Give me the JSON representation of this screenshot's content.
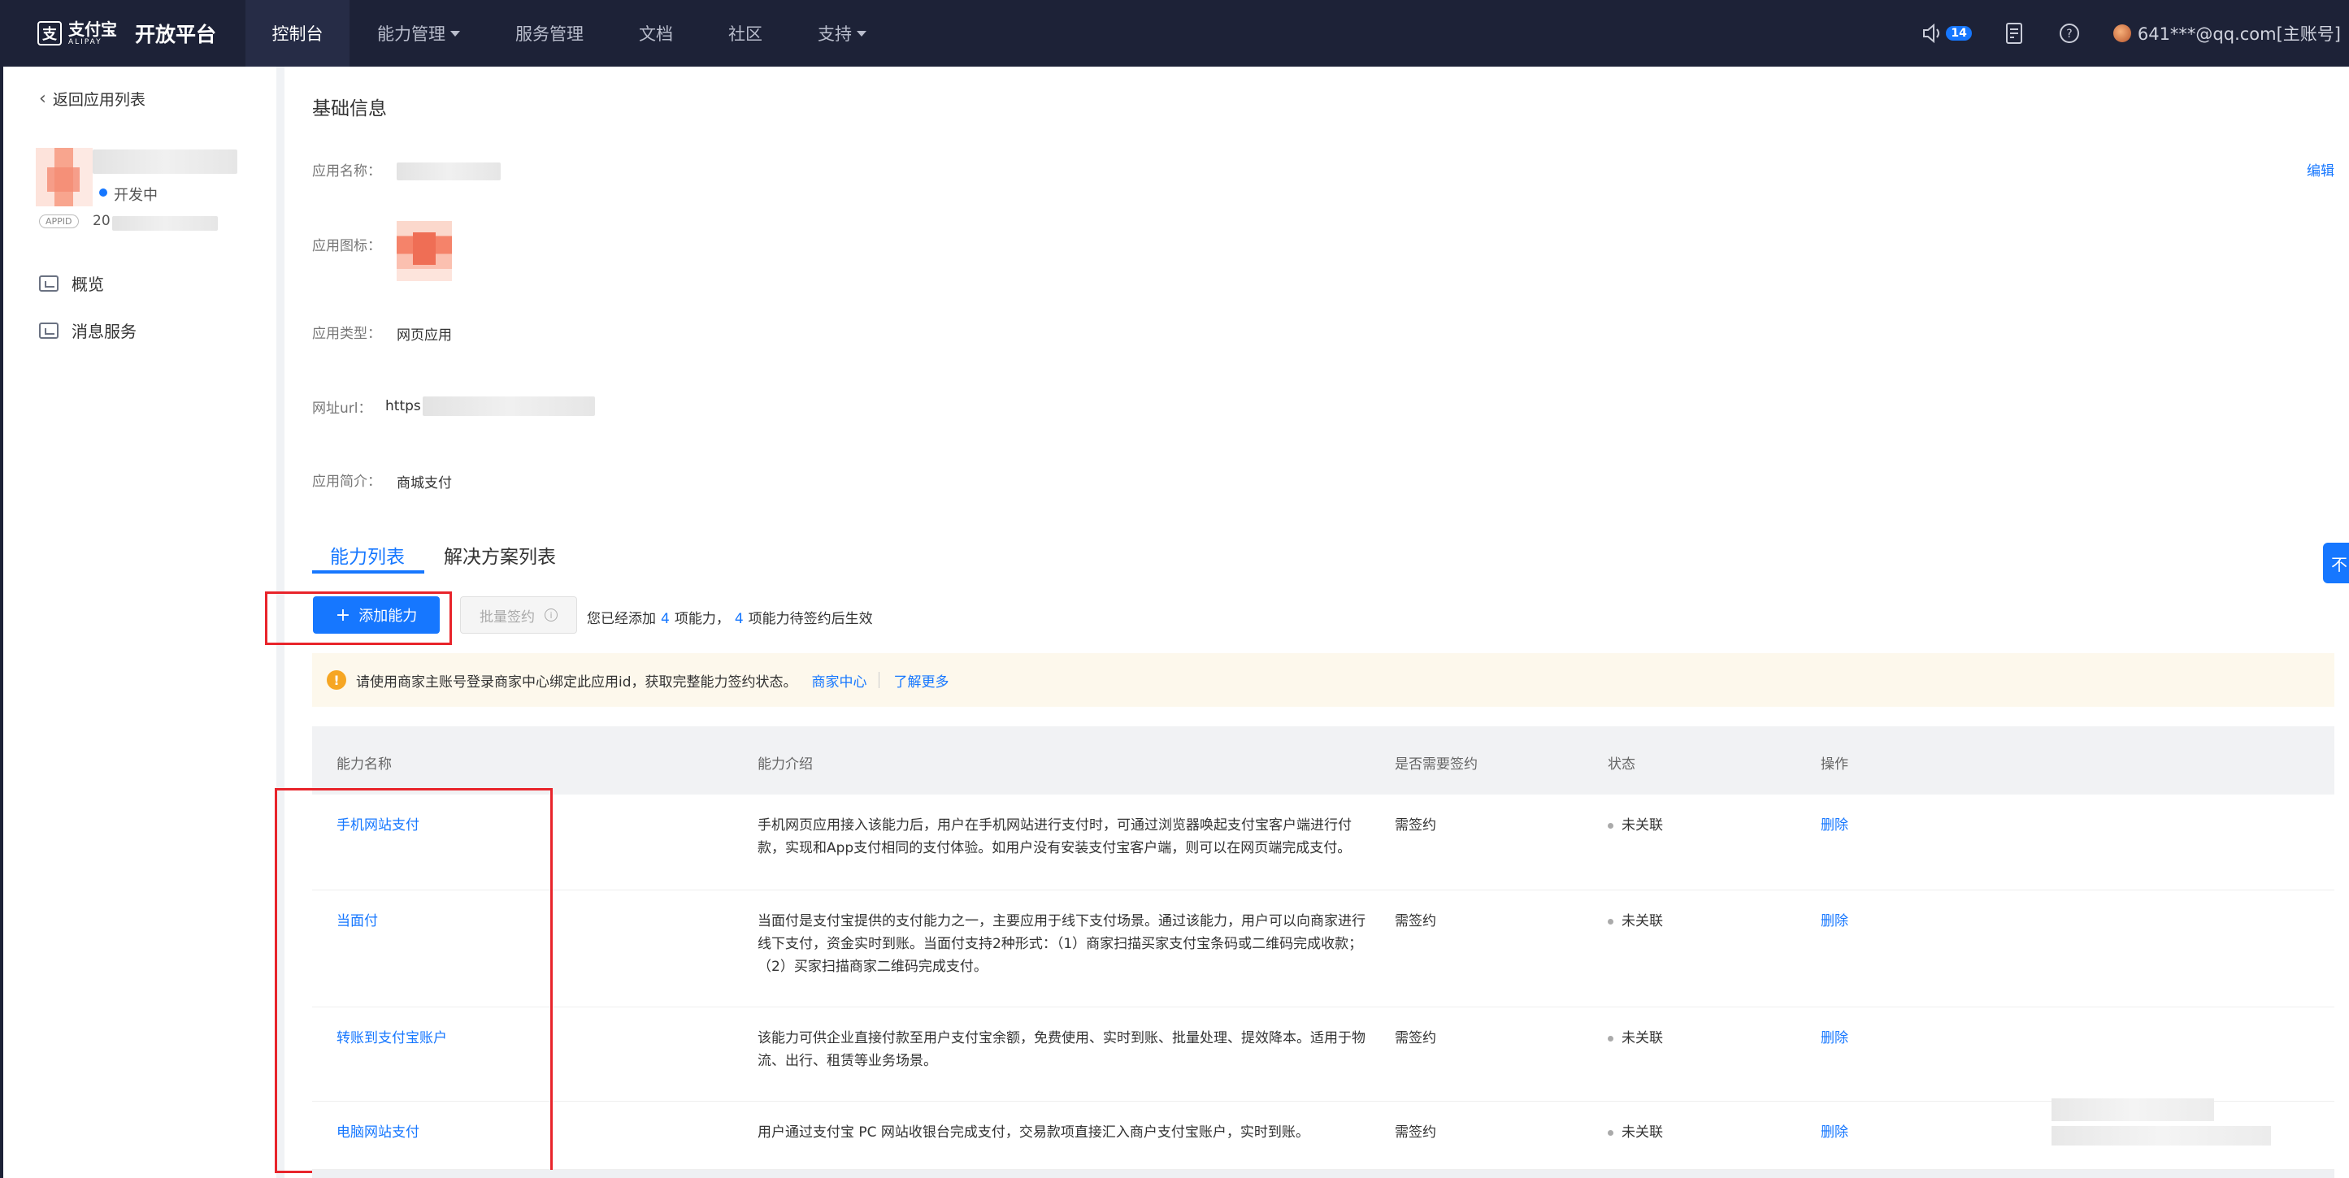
{
  "nav": {
    "brand_cn": "支付宝",
    "brand_en": "ALIPAY",
    "brand_title": "开放平台",
    "items": [
      {
        "label": "控制台"
      },
      {
        "label": "能力管理"
      },
      {
        "label": "服务管理"
      },
      {
        "label": "文档"
      },
      {
        "label": "社区"
      },
      {
        "label": "支持"
      }
    ],
    "notification_count": "14",
    "user": "641***@qq.com[主账号]"
  },
  "sidebar": {
    "back": "返回应用列表",
    "status": "开发中",
    "appid_tag": "APPID",
    "appid_prefix": "20",
    "menu": [
      {
        "label": "概览"
      },
      {
        "label": "消息服务"
      }
    ]
  },
  "basic": {
    "title": "基础信息",
    "edit": "编辑",
    "name_label": "应用名称：",
    "icon_label": "应用图标：",
    "type_label": "应用类型：",
    "type_value": "网页应用",
    "url_label": "网址url：",
    "url_value": "https",
    "intro_label": "应用简介：",
    "intro_value": "商城支付"
  },
  "tabs": {
    "active": "能力列表",
    "inactive": "解决方案列表"
  },
  "float_btn": "不",
  "actions": {
    "add": "添加能力",
    "batch": "批量签约",
    "summary_pre": "您已经添加",
    "summary_count": "4",
    "summary_mid": "项能力，",
    "summary_pending": "4",
    "summary_post": "项能力待签约后生效"
  },
  "alert": {
    "text": "请使用商家主账号登录商家中心绑定此应用id，获取完整能力签约状态。",
    "link1": "商家中心",
    "link2": "了解更多"
  },
  "table": {
    "headers": [
      "能力名称",
      "能力介绍",
      "是否需要签约",
      "状态",
      "操作"
    ],
    "rows": [
      {
        "name": "手机网站支付",
        "desc": "手机网页应用接入该能力后，用户在手机网站进行支付时，可通过浏览器唤起支付宝客户端进行付款，实现和App支付相同的支付体验。如用户没有安装支付宝客户端，则可以在网页端完成支付。",
        "sign": "需签约",
        "status": "未关联",
        "op": "删除"
      },
      {
        "name": "当面付",
        "desc": "当面付是支付宝提供的支付能力之一，主要应用于线下支付场景。通过该能力，用户可以向商家进行线下支付，资金实时到账。当面付支持2种形式：（1）商家扫描买家支付宝条码或二维码完成收款；（2）买家扫描商家二维码完成支付。",
        "sign": "需签约",
        "status": "未关联",
        "op": "删除"
      },
      {
        "name": "转账到支付宝账户",
        "desc": "该能力可供企业直接付款至用户支付宝余额，免费使用、实时到账、批量处理、提效降本。适用于物流、出行、租赁等业务场景。",
        "sign": "需签约",
        "status": "未关联",
        "op": "删除"
      },
      {
        "name": "电脑网站支付",
        "desc": "用户通过支付宝 PC 网站收银台完成支付，交易款项直接汇入商户支付宝账户，实时到账。",
        "sign": "需签约",
        "status": "未关联",
        "op": "删除"
      }
    ]
  },
  "colors": {
    "nav_bg": "#1d2237",
    "accent": "#1677ff",
    "highlight": "#e8242b",
    "alert_bg": "#fdf8ec",
    "warn": "#f6a623"
  }
}
